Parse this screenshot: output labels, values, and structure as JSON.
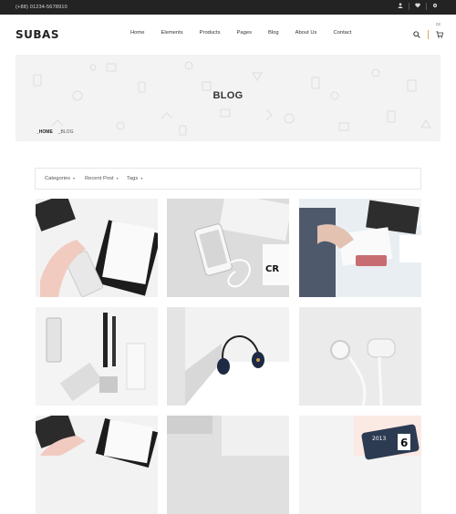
{
  "topbar": {
    "phone": "(+88) 01234-5678910",
    "icons": [
      "user-icon",
      "heart-icon",
      "settings-icon"
    ]
  },
  "header": {
    "logo": "SUBAS",
    "nav": [
      "Home",
      "Elements",
      "Products",
      "Pages",
      "Blog",
      "About Us",
      "Contact"
    ],
    "cart_count": "02"
  },
  "banner": {
    "title": "BLOG",
    "breadcrumb": {
      "home": "_HOME",
      "current": "_BLOG"
    }
  },
  "filter": {
    "items": [
      "Categories",
      "Recent Post",
      "Tags"
    ],
    "chevron": "▾"
  },
  "posts": [
    {
      "image": "hand-with-notebook-and-phone"
    },
    {
      "image": "phone-earphones-desk"
    },
    {
      "image": "person-writing-at-laptop"
    },
    {
      "image": "stationery-pens-calculator"
    },
    {
      "image": "headphones-on-white-blocks"
    },
    {
      "image": "white-earphones"
    },
    {
      "image": "hand-with-notebook-and-phone"
    },
    {
      "image": "desk-top-view"
    },
    {
      "image": "calendar-clock-2013"
    }
  ],
  "colors": {
    "topbar": "#232323",
    "accent": "#e1a25e",
    "banner_bg": "#f3f3f3"
  }
}
